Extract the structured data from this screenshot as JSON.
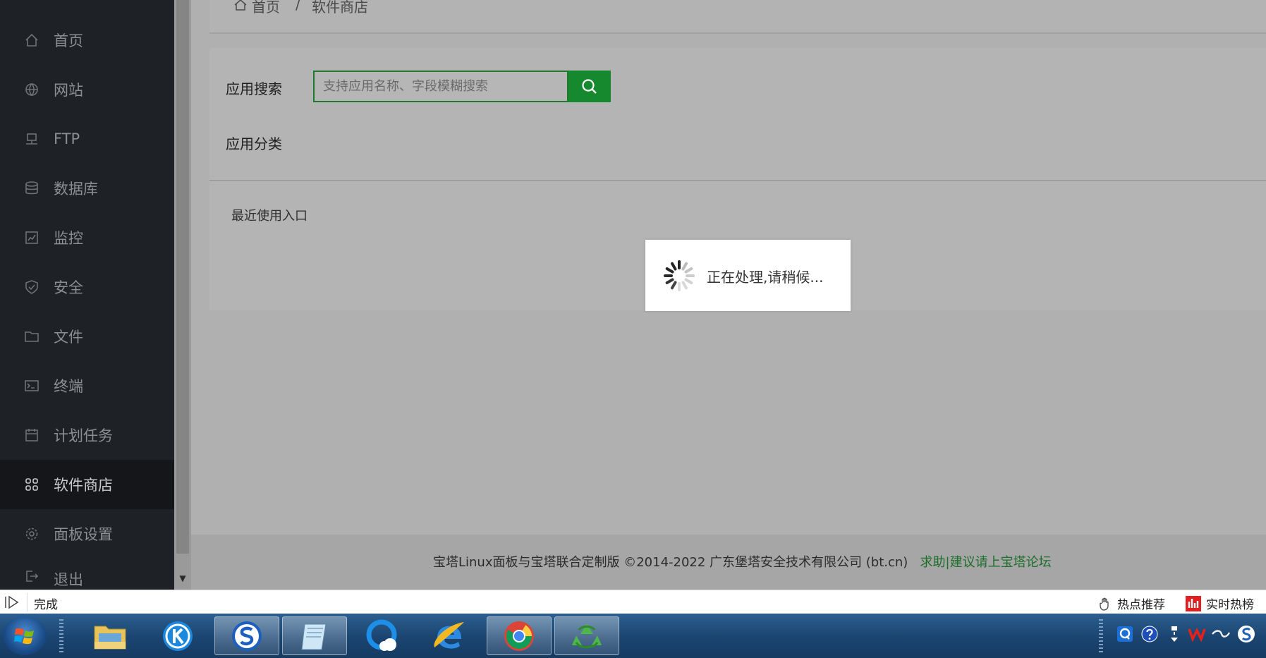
{
  "breadcrumb": {
    "home": "首页",
    "separator": "/",
    "current": "软件商店"
  },
  "sidebar": {
    "items": [
      {
        "label": "首页",
        "icon": "home-icon"
      },
      {
        "label": "网站",
        "icon": "globe-icon"
      },
      {
        "label": "FTP",
        "icon": "ftp-icon"
      },
      {
        "label": "数据库",
        "icon": "database-icon"
      },
      {
        "label": "监控",
        "icon": "monitor-icon"
      },
      {
        "label": "安全",
        "icon": "shield-icon"
      },
      {
        "label": "文件",
        "icon": "folder-icon"
      },
      {
        "label": "终端",
        "icon": "terminal-icon"
      },
      {
        "label": "计划任务",
        "icon": "calendar-icon"
      },
      {
        "label": "软件商店",
        "icon": "apps-icon",
        "active": true
      },
      {
        "label": "面板设置",
        "icon": "gear-icon"
      },
      {
        "label": "退出",
        "icon": "logout-icon"
      }
    ]
  },
  "search": {
    "label": "应用搜索",
    "placeholder": "支持应用名称、字段模糊搜索"
  },
  "category": {
    "label": "应用分类"
  },
  "recent": {
    "label": "最近使用入口"
  },
  "loading": {
    "text": "正在处理,请稍候..."
  },
  "footer": {
    "copyright": "宝塔Linux面板与宝塔联合定制版 ©2014-2022 广东堡塔安全技术有限公司 (bt.cn)",
    "help_link": "求助|建议请上宝塔论坛"
  },
  "statusbar": {
    "status": "完成",
    "hot": "热点推荐",
    "ranking": "实时热榜"
  },
  "colors": {
    "accent": "#16892f",
    "sidebar_bg": "#1e2227",
    "link": "#1c6e2a"
  }
}
